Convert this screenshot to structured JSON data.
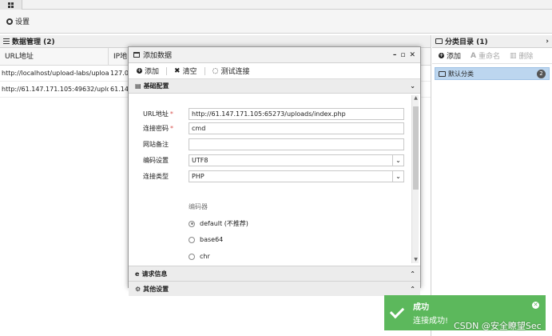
{
  "toolbar": {
    "settings_label": "设置"
  },
  "data_panel": {
    "title": "数据管理 (2)",
    "columns": [
      "URL地址",
      "IP地"
    ],
    "rows": [
      {
        "url": "http://localhost/upload-labs/uploa",
        "ip": "127.0"
      },
      {
        "url": "http://61.147.171.105:49632/uplo",
        "ip": "61.14"
      }
    ]
  },
  "category_panel": {
    "title": "分类目录 (1)",
    "add_label": "添加",
    "rename_label": "重命名",
    "delete_label": "删除",
    "items": [
      {
        "label": "默认分类",
        "count": "2"
      }
    ]
  },
  "modal": {
    "title": "添加数据",
    "add_label": "添加",
    "clear_label": "清空",
    "test_label": "测试连接",
    "section_basic": "基础配置",
    "fields": {
      "url_label": "URL地址",
      "url_value": "http://61.147.171.105:65273/uploads/index.php",
      "password_label": "连接密码",
      "password_value": "cmd",
      "note_label": "网站备注",
      "note_value": "",
      "encoding_label": "编码设置",
      "encoding_value": "UTF8",
      "type_label": "连接类型",
      "type_value": "PHP"
    },
    "encoder_label": "编码器",
    "encoders": [
      {
        "label": "default (不推荐)",
        "checked": true
      },
      {
        "label": "base64",
        "checked": false
      },
      {
        "label": "chr",
        "checked": false
      }
    ],
    "section_request": "请求信息",
    "section_other": "其他设置"
  },
  "toast": {
    "title": "成功",
    "message": "连接成功!",
    "color": "#5cb85c"
  },
  "watermark": "CSDN @安全瞭望Sec"
}
